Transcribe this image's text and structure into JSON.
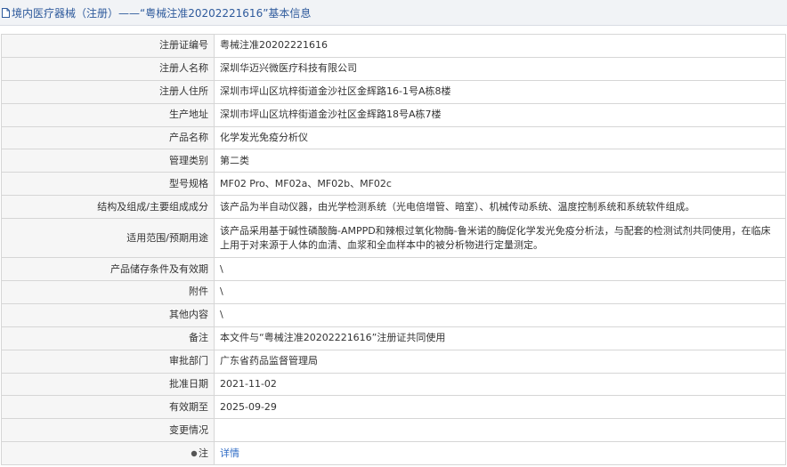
{
  "header": {
    "title": "境内医疗器械（注册）——“粤械注准20202221616”基本信息",
    "icon": "document-icon"
  },
  "rows": [
    {
      "label": "注册证编号",
      "value": "粤械注准20202221616"
    },
    {
      "label": "注册人名称",
      "value": "深圳华迈兴微医疗科技有限公司"
    },
    {
      "label": "注册人住所",
      "value": "深圳市坪山区坑梓街道金沙社区金辉路16-1号A栋8楼"
    },
    {
      "label": "生产地址",
      "value": "深圳市坪山区坑梓街道金沙社区金辉路18号A栋7楼"
    },
    {
      "label": "产品名称",
      "value": "化学发光免疫分析仪"
    },
    {
      "label": "管理类别",
      "value": "第二类"
    },
    {
      "label": "型号规格",
      "value": "MF02 Pro、MF02a、MF02b、MF02c"
    },
    {
      "label": "结构及组成/主要组成成分",
      "value": "该产品为半自动仪器，由光学检测系统（光电倍增管、暗室）、机械传动系统、温度控制系统和系统软件组成。"
    },
    {
      "label": "适用范围/预期用途",
      "value": "该产品采用基于碱性磷酸酶-AMPPD和辣根过氧化物酶-鲁米诺的酶促化学发光免疫分析法，与配套的检测试剂共同使用，在临床上用于对来源于人体的血清、血浆和全血样本中的被分析物进行定量测定。"
    },
    {
      "label": "产品储存条件及有效期",
      "value": "\\"
    },
    {
      "label": "附件",
      "value": "\\"
    },
    {
      "label": "其他内容",
      "value": "\\"
    },
    {
      "label": "备注",
      "value": "本文件与“粤械注准20202221616”注册证共同使用"
    },
    {
      "label": "审批部门",
      "value": "广东省药品监督管理局"
    },
    {
      "label": "批准日期",
      "value": "2021-11-02"
    },
    {
      "label": "有效期至",
      "value": "2025-09-29"
    },
    {
      "label": "变更情况",
      "value": ""
    }
  ],
  "note": {
    "label": "注",
    "icon": "dot-icon",
    "link_text": "详情"
  }
}
